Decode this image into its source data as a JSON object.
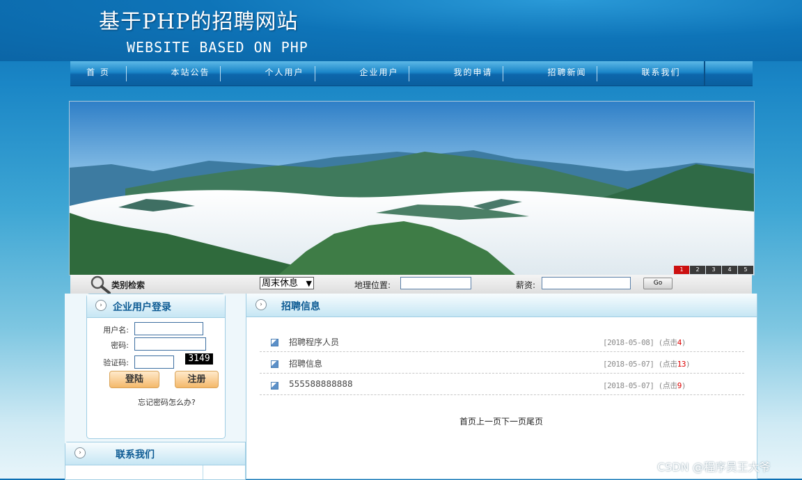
{
  "header": {
    "title": "基于PHP的招聘网站",
    "subtitle": "WEBSITE BASED ON PHP"
  },
  "nav": {
    "items": [
      "首 页",
      "本站公告",
      "个人用户",
      "企业用户",
      "我的申请",
      "招聘新闻",
      "联系我们"
    ]
  },
  "banner": {
    "slides": [
      "1",
      "2",
      "3",
      "4",
      "5"
    ],
    "active_slide": 1
  },
  "search": {
    "title": "类别检索",
    "category_selected": "周末休息",
    "location_label": "地理位置:",
    "location_value": "",
    "salary_label": "薪资:",
    "salary_value": "",
    "go_label": "Go"
  },
  "login": {
    "title": "企业用户登录",
    "username_label": "用户名:",
    "password_label": "密码:",
    "captcha_label": "验证码:",
    "captcha_code": "3149",
    "login_button": "登陆",
    "register_button": "注册",
    "forgot_link": "忘记密码怎么办?"
  },
  "contact": {
    "title": "联系我们"
  },
  "recruitment": {
    "title": "招聘信息",
    "items": [
      {
        "title": "招聘程序人员",
        "date": "[2018-05-08]",
        "hits_prefix": "(点击",
        "hits": "4",
        "hits_suffix": ")"
      },
      {
        "title": "招聘信息",
        "date": "[2018-05-07]",
        "hits_prefix": "(点击",
        "hits": "13",
        "hits_suffix": ")"
      },
      {
        "title": "555588888888",
        "date": "[2018-05-07]",
        "hits_prefix": "(点击",
        "hits": "9",
        "hits_suffix": ")"
      }
    ],
    "pagination": [
      "首页",
      "上一页",
      "下一页",
      "尾页"
    ]
  },
  "watermark": "CSDN @程序员王大爷",
  "colors": {
    "nav_blue": "#0d66ab",
    "header_text": "#0c5a93",
    "hit_count": "#dd0000",
    "active_slide": "#cc1010"
  }
}
